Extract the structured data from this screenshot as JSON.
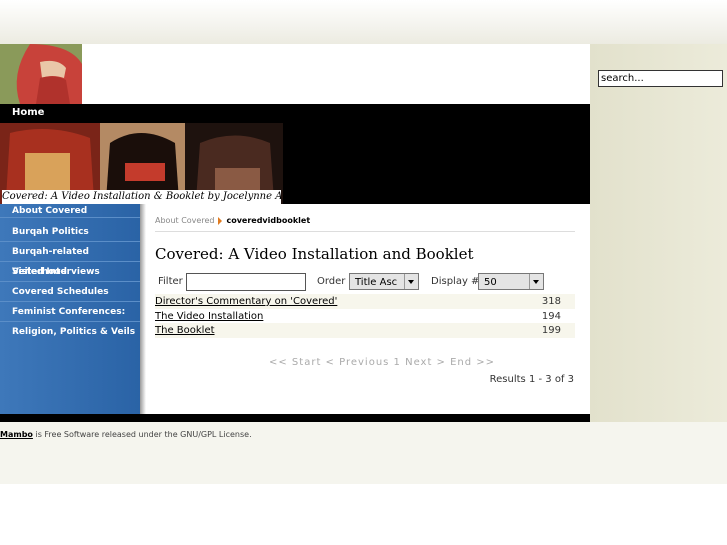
{
  "search": {
    "placeholder": "search..."
  },
  "nav": {
    "home": "Home"
  },
  "banner": {
    "caption": "Covered: A Video Installation & Booklet by Jocelynne A Scutt"
  },
  "sidebar": {
    "items": [
      {
        "label": "About Covered"
      },
      {
        "label": "Burqah Politics"
      },
      {
        "label": "Burqah-related Sisterhood"
      },
      {
        "label": "Veiled Interviews"
      },
      {
        "label": "Covered Schedules"
      },
      {
        "label": "Feminist Conferences:"
      },
      {
        "label": "Religion, Politics & Veils"
      }
    ]
  },
  "breadcrumb": {
    "parent": "About Covered",
    "current": "coveredvidbooklet"
  },
  "page": {
    "title": "Covered: A Video Installation and Booklet"
  },
  "controls": {
    "filter_label": "Filter",
    "filter_value": "",
    "order_label": "Order",
    "order_value": "Title Asc",
    "display_label": "Display #",
    "display_value": "50"
  },
  "table": {
    "rows": [
      {
        "title": "Director's Commentary on 'Covered'",
        "hits": "318"
      },
      {
        "title": "The Video Installation",
        "hits": "194"
      },
      {
        "title": "The Booklet",
        "hits": "199"
      }
    ]
  },
  "pager": {
    "text": "<< Start < Previous 1 Next > End >>"
  },
  "results": "Results 1 - 3 of 3",
  "footer": {
    "link": "Mambo",
    "text": " is Free Software released under the GNU/GPL License."
  }
}
